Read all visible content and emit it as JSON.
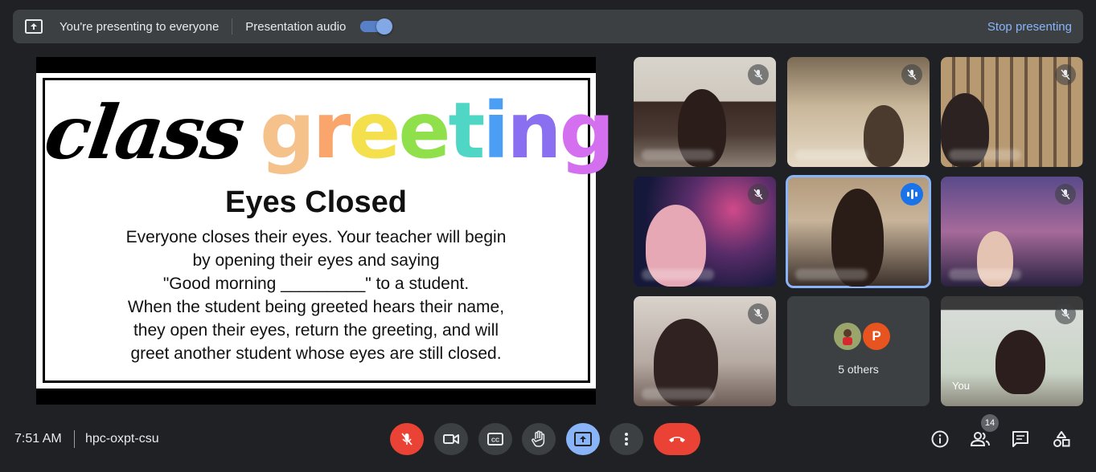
{
  "banner": {
    "message": "You're presenting to everyone",
    "audio_label": "Presentation audio",
    "audio_enabled": true,
    "stop_label": "Stop presenting"
  },
  "slide": {
    "title_word1": "class",
    "title_word2_letters": [
      {
        "ch": "g",
        "color": "#f6c28b"
      },
      {
        "ch": "r",
        "color": "#f9a56b"
      },
      {
        "ch": "e",
        "color": "#f4e04d"
      },
      {
        "ch": "e",
        "color": "#8fe04b"
      },
      {
        "ch": "t",
        "color": "#4fd6c5"
      },
      {
        "ch": "i",
        "color": "#4a9ff5"
      },
      {
        "ch": "n",
        "color": "#8a6ff0"
      },
      {
        "ch": "g",
        "color": "#d46ff0"
      }
    ],
    "heading": "Eyes Closed",
    "lines": [
      "Everyone closes their eyes. Your teacher will begin",
      "by opening their eyes and saying",
      "\"Good morning _________\" to a student.",
      "When the student being greeted hears their name,",
      "they open their eyes, return the greeting, and will",
      "greet another student whose eyes are still closed."
    ]
  },
  "tiles": {
    "others_label": "5 others",
    "others_avatar_letter": "P",
    "you_label": "You"
  },
  "bottom": {
    "time": "7:51 AM",
    "meeting_code": "hpc-oxpt-csu",
    "people_count": "14"
  },
  "colors": {
    "background": "#202124",
    "panel": "#3c4043",
    "accent": "#8ab4f8",
    "danger": "#ea4335"
  }
}
